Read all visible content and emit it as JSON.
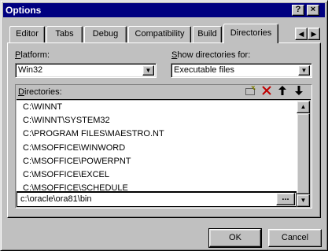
{
  "window": {
    "title": "Options",
    "help_glyph": "?",
    "close_glyph": "×"
  },
  "tabs": [
    {
      "label": "Editor",
      "active": false
    },
    {
      "label": "Tabs",
      "active": false
    },
    {
      "label": "Debug",
      "active": false
    },
    {
      "label": "Compatibility",
      "active": false
    },
    {
      "label": "Build",
      "active": false
    },
    {
      "label": "Directories",
      "active": true
    }
  ],
  "tab_scroll": {
    "left": "◀",
    "right": "▶"
  },
  "platform": {
    "label_u": "P",
    "label_rest": "latform:",
    "value": "Win32"
  },
  "show_dirs": {
    "label_u": "S",
    "label_rest": "how directories for:",
    "value": "Executable files"
  },
  "directories": {
    "label_u": "D",
    "label_rest": "irectories:",
    "items": [
      "C:\\WINNT",
      "C:\\WINNT\\SYSTEM32",
      "C:\\PROGRAM FILES\\MAESTRO.NT",
      "C:\\MSOFFICE\\WINWORD",
      "C:\\MSOFFICE\\POWERPNT",
      "C:\\MSOFFICE\\EXCEL",
      "C:\\MSOFFICE\\SCHEDULE"
    ],
    "edit_value": "c:\\oracle\\ora81\\bin",
    "ellipsis": "..."
  },
  "toolbar_icons": [
    "new-folder-icon",
    "delete-icon",
    "move-up-icon",
    "move-down-icon"
  ],
  "buttons": {
    "ok": "OK",
    "cancel": "Cancel"
  },
  "colors": {
    "titlebar": "#000080",
    "face": "#c0c0c0",
    "delete": "#c00000"
  }
}
